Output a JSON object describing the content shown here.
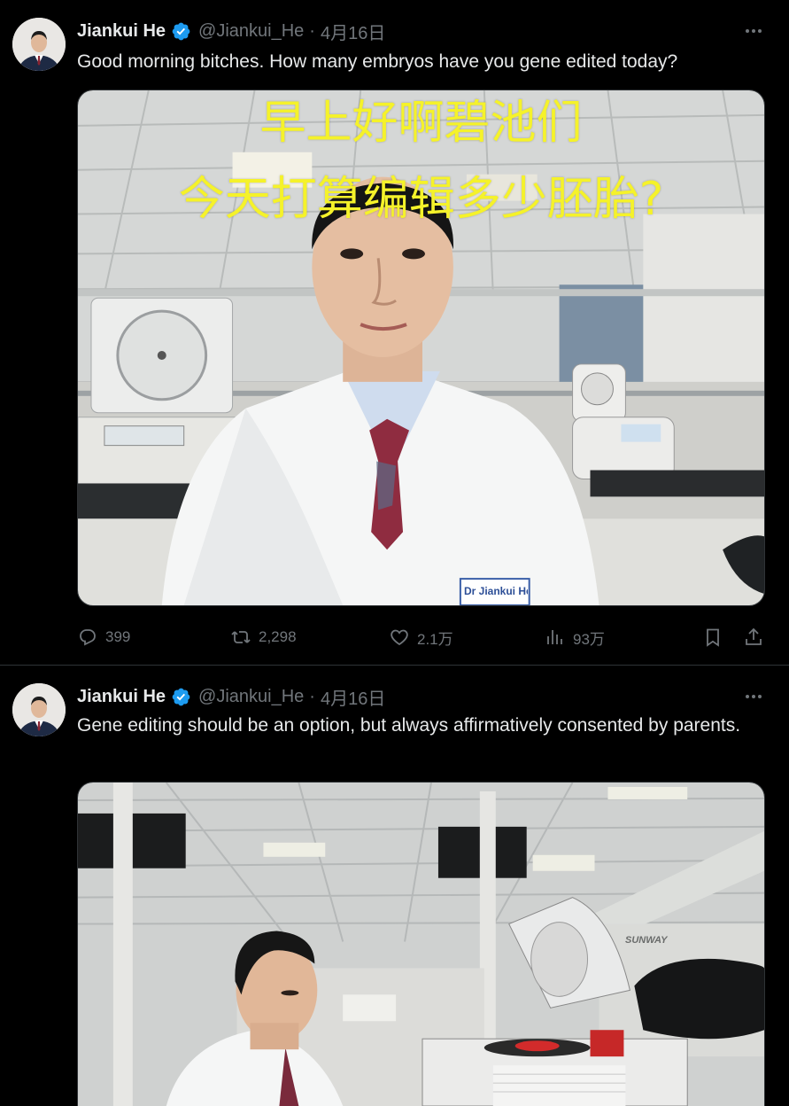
{
  "tweets": [
    {
      "author": {
        "name": "Jiankui He",
        "handle": "@Jiankui_He",
        "verified": true
      },
      "separator": "·",
      "date": "4月16日",
      "text": "Good morning bitches. How many embryos have you gene edited today?",
      "media": {
        "caption_line1": "早上好啊碧池们",
        "caption_line2": "今天打算编辑多少胚胎?",
        "coat_tag": "Dr Jiankui He"
      },
      "stats": {
        "replies": "399",
        "reposts": "2,298",
        "likes": "2.1万",
        "views": "93万"
      }
    },
    {
      "author": {
        "name": "Jiankui He",
        "handle": "@Jiankui_He",
        "verified": true
      },
      "separator": "·",
      "date": "4月16日",
      "text": "Gene editing should be an option, but always affirmatively consented by parents.",
      "media": {
        "sign_text": "SUNWAY"
      }
    }
  ],
  "icons": {
    "verified": "verified-badge-icon",
    "more": "more-dots-icon",
    "reply": "reply-icon",
    "repost": "repost-icon",
    "like": "heart-icon",
    "views": "views-chart-icon",
    "bookmark": "bookmark-icon",
    "share": "share-icon"
  },
  "colors": {
    "background": "#000000",
    "text": "#e7e9ea",
    "secondary": "#71767b",
    "verified": "#1d9bf0",
    "caption": "#f5f22a"
  }
}
